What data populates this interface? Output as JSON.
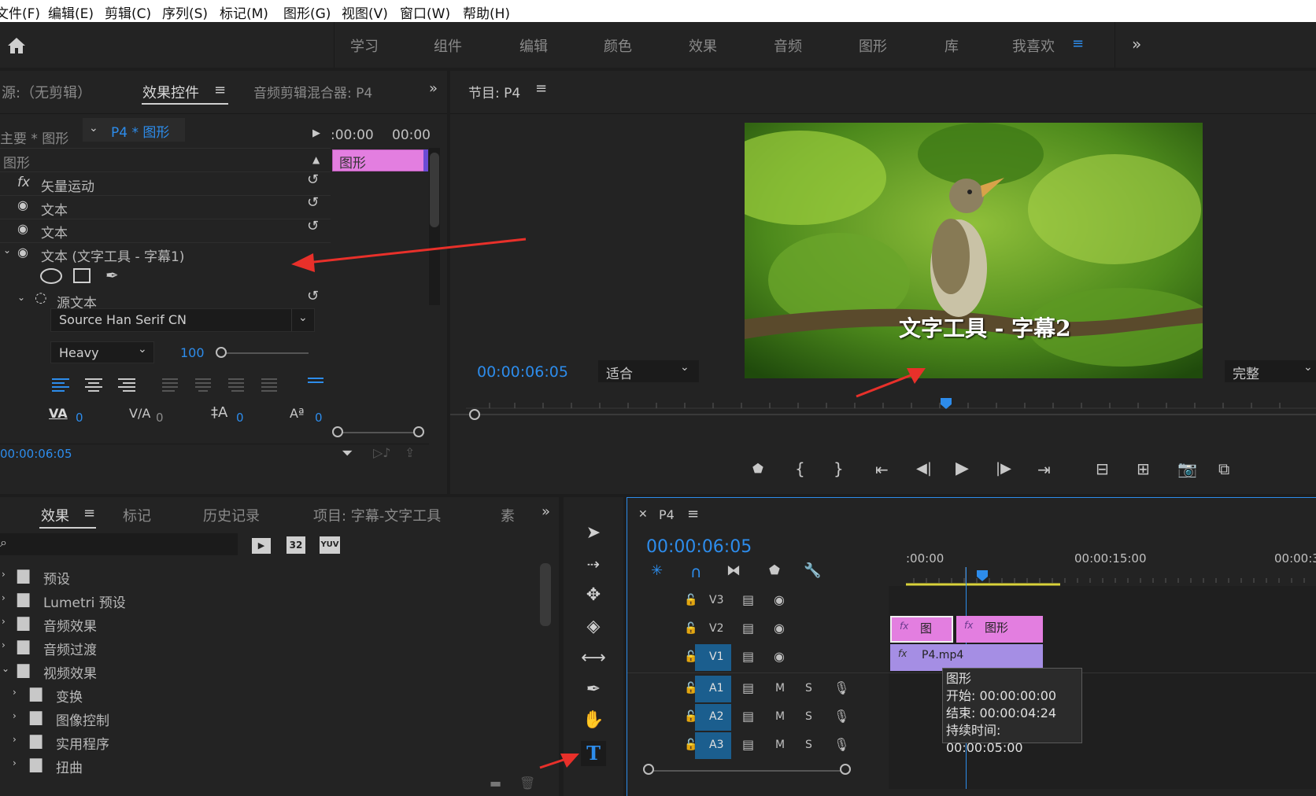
{
  "menubar": {
    "items": [
      "文件(F)",
      "编辑(E)",
      "剪辑(C)",
      "序列(S)",
      "标记(M)",
      "图形(G)",
      "视图(V)",
      "窗口(W)",
      "帮助(H)"
    ]
  },
  "workspace": {
    "tabs": [
      "学习",
      "组件",
      "编辑",
      "颜色",
      "效果",
      "音频",
      "图形",
      "库",
      "我喜欢"
    ],
    "active": "我喜欢"
  },
  "source_panel": {
    "tab_source": "源:（无剪辑）",
    "tab_effects": "效果控件",
    "tab_mixer": "音频剪辑混合器: P4",
    "clip_main": "主要 * 图形",
    "clip_seq": "P4 * 图形",
    "ruler_a": ":00:00",
    "ruler_b": "00:00",
    "clip_bar": "图形",
    "section": "图形",
    "rows": [
      "矢量运动",
      "文本",
      "文本",
      "文本 (文字工具 - 字幕1)"
    ],
    "source_text": "源文本",
    "font": "Source Han Serif CN",
    "weight": "Heavy",
    "size": "100",
    "kerning": "0",
    "tracking": "0",
    "leading": "0",
    "baseline": "0",
    "timecode": "00:00:06:05"
  },
  "program_panel": {
    "title": "节目: P4",
    "caption": "文字工具 - 字幕2",
    "timecode": "00:00:06:05",
    "fit": "适合",
    "quality": "完整"
  },
  "effects_panel": {
    "tabs": [
      "效果",
      "标记",
      "历史记录",
      "项目: 字幕-文字工具",
      "素"
    ],
    "badges": [
      "32",
      "YUV"
    ],
    "tree": [
      "预设",
      "Lumetri 预设",
      "音频效果",
      "音频过渡",
      "视频效果",
      "变换",
      "图像控制",
      "实用程序",
      "扭曲"
    ]
  },
  "timeline": {
    "title": "P4",
    "timecode": "00:00:06:05",
    "ruler": [
      ":00:00",
      "00:00:15:00",
      "00:00:3"
    ],
    "video_tracks": [
      "V3",
      "V2",
      "V1"
    ],
    "audio_tracks": [
      "A1",
      "A2",
      "A3"
    ],
    "clip_v2a": "图",
    "clip_v2b": "图形",
    "clip_v1": "P4.mp4",
    "tooltip": {
      "title": "图形",
      "start": "开始: 00:00:00:00",
      "end": "结束: 00:00:04:24",
      "duration": "持续时间: 00:00:05:00"
    }
  },
  "colors": {
    "accent": "#2d8ceb",
    "clip_pink": "#e37ee0",
    "clip_violet": "#a58ee4",
    "arrow": "#e8302a"
  }
}
